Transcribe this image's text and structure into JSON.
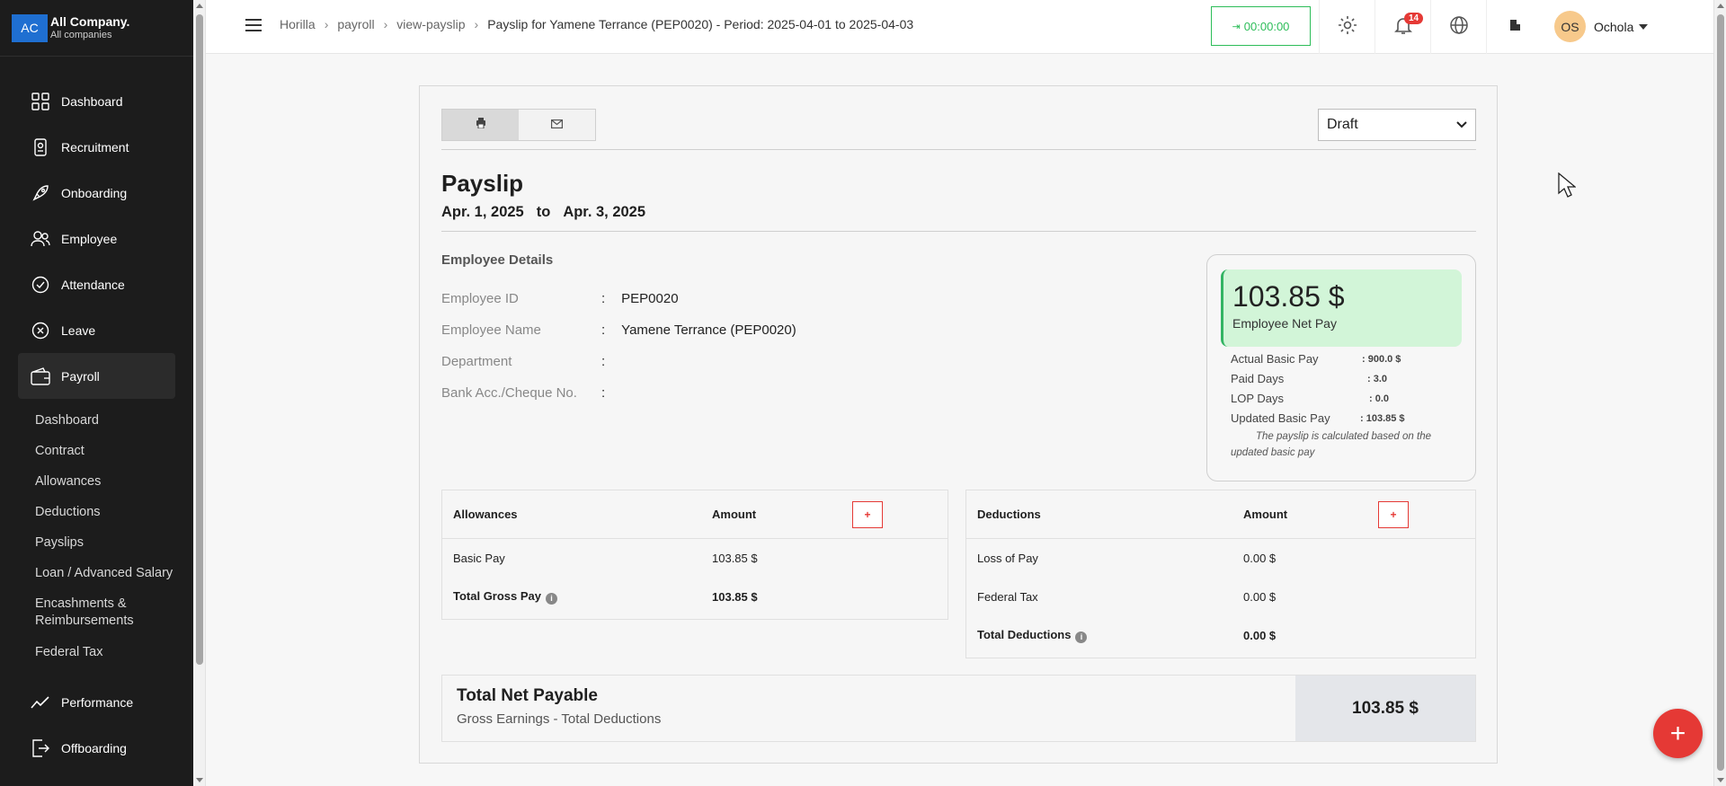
{
  "company": {
    "logo": "AC",
    "name": "All Company.",
    "subtitle": "All companies"
  },
  "sidebar": {
    "items": [
      {
        "label": "Dashboard",
        "icon": "dashboard-icon"
      },
      {
        "label": "Recruitment",
        "icon": "recruitment-icon"
      },
      {
        "label": "Onboarding",
        "icon": "rocket-icon"
      },
      {
        "label": "Employee",
        "icon": "people-icon"
      },
      {
        "label": "Attendance",
        "icon": "check-circle-icon"
      },
      {
        "label": "Leave",
        "icon": "x-circle-icon"
      },
      {
        "label": "Payroll",
        "icon": "wallet-icon"
      },
      {
        "label": "Performance",
        "icon": "trend-icon"
      },
      {
        "label": "Offboarding",
        "icon": "exit-icon"
      }
    ],
    "payroll_sub": [
      "Dashboard",
      "Contract",
      "Allowances",
      "Deductions",
      "Payslips",
      "Loan / Advanced Salary",
      "Encashments & Reimbursements",
      "Federal Tax"
    ]
  },
  "header": {
    "breadcrumb": [
      "Horilla",
      "payroll",
      "view-payslip",
      "Payslip for Yamene Terrance (PEP0020) - Period: 2025-04-01 to 2025-04-03"
    ],
    "timer": "00:00:00",
    "notifications": "14",
    "user": {
      "initials": "OS",
      "name": "Ochola"
    }
  },
  "payslip": {
    "status": "Draft",
    "title": "Payslip",
    "start": "Apr. 1, 2025",
    "to": "to",
    "end": "Apr. 3, 2025",
    "section_title": "Employee Details",
    "details": [
      {
        "label": "Employee ID",
        "value": "PEP0020"
      },
      {
        "label": "Employee Name",
        "value": "Yamene Terrance (PEP0020)"
      },
      {
        "label": "Department",
        "value": ""
      },
      {
        "label": "Bank Acc./Cheque No.",
        "value": ""
      }
    ],
    "net": {
      "amount": "103.85 $",
      "label": "Employee Net Pay",
      "rows": [
        {
          "label": "Actual Basic Pay",
          "value": ": 900.0 $"
        },
        {
          "label": "Paid Days",
          "value": ": 3.0"
        },
        {
          "label": "LOP Days",
          "value": ": 0.0"
        },
        {
          "label": "Updated Basic Pay",
          "value": ": 103.85 $"
        }
      ],
      "note": "The payslip is calculated based on the updated basic pay"
    },
    "allowances": {
      "header": "Allowances",
      "amount_header": "Amount",
      "add": "+",
      "rows": [
        {
          "label": "Basic Pay",
          "value": "103.85 $"
        }
      ],
      "total_label": "Total Gross Pay",
      "total_value": "103.85 $"
    },
    "deductions": {
      "header": "Deductions",
      "amount_header": "Amount",
      "add": "+",
      "rows": [
        {
          "label": "Loss of Pay",
          "value": "0.00 $"
        },
        {
          "label": "Federal Tax",
          "value": "0.00 $"
        }
      ],
      "total_label": "Total Deductions",
      "total_value": "0.00 $"
    },
    "total": {
      "title": "Total Net Payable",
      "subtitle": "Gross Earnings - Total Deductions",
      "amount": "103.85 $"
    }
  },
  "fab": "+"
}
